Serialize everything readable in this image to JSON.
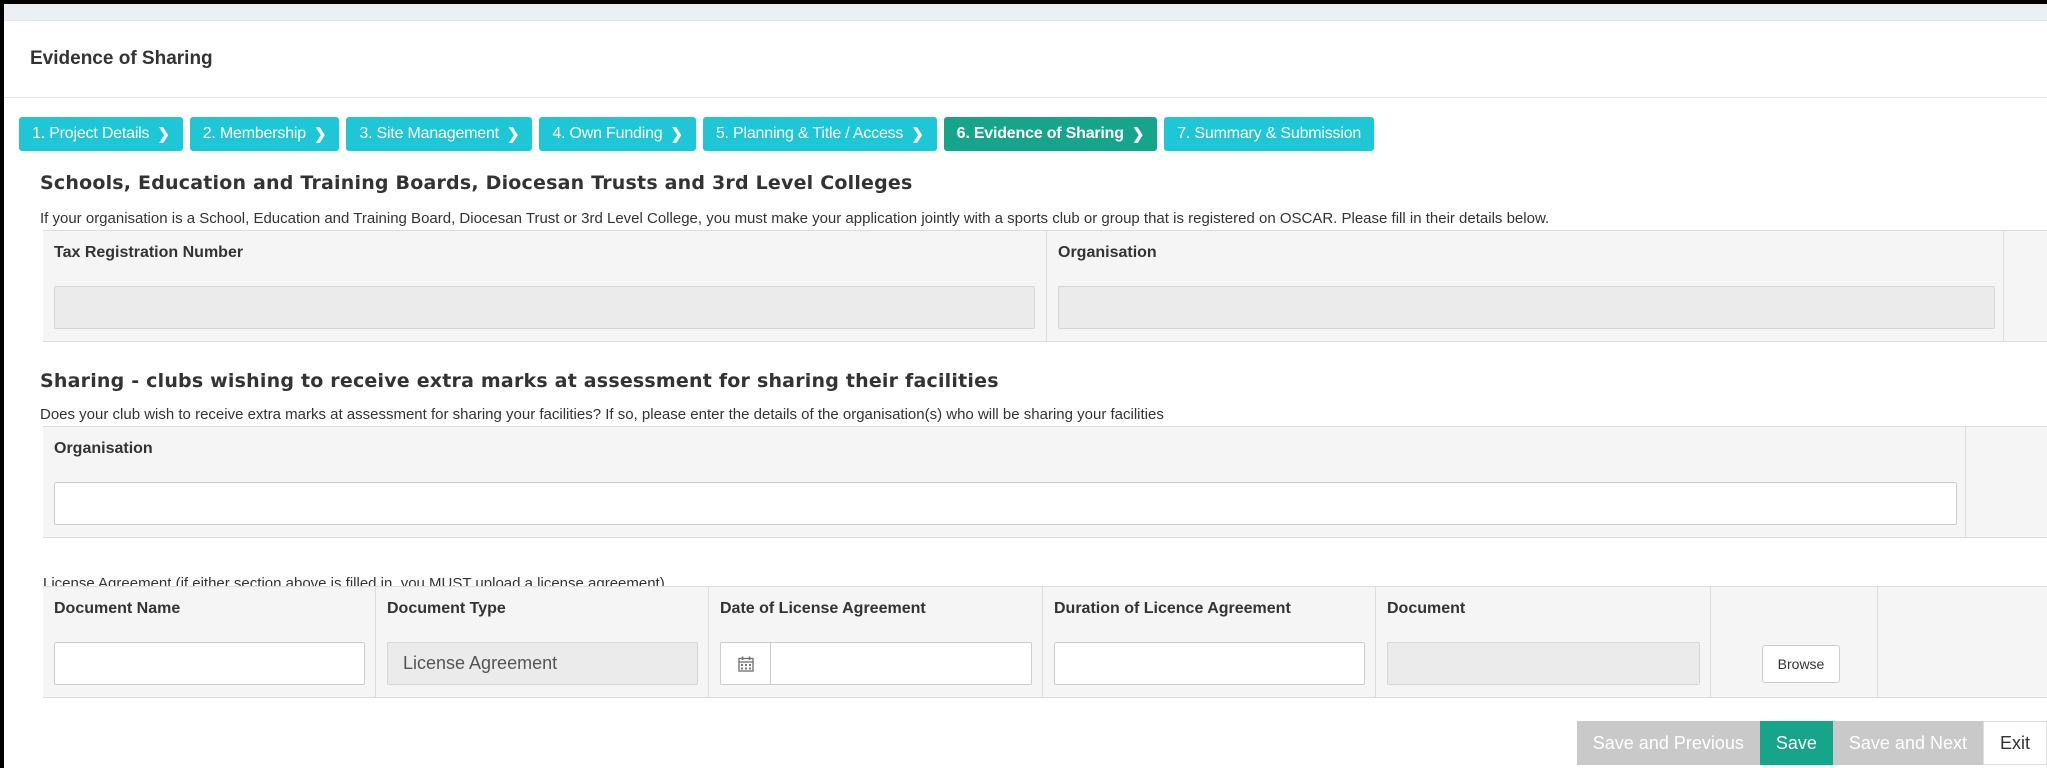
{
  "page": {
    "title": "Evidence of Sharing"
  },
  "tabs": [
    {
      "label": "1. Project Details",
      "active": false
    },
    {
      "label": "2. Membership",
      "active": false
    },
    {
      "label": "3. Site Management",
      "active": false
    },
    {
      "label": "4. Own Funding",
      "active": false
    },
    {
      "label": "5. Planning & Title / Access",
      "active": false
    },
    {
      "label": "6. Evidence of Sharing",
      "active": true
    },
    {
      "label": "7. Summary & Submission",
      "active": false
    }
  ],
  "schools_section": {
    "title": "Schools, Education and Training Boards, Diocesan Trusts and 3rd Level Colleges",
    "description": "If your organisation is a School, Education and Training Board, Diocesan Trust or 3rd Level College, you must make your application jointly with a sports club or group that is registered on OSCAR. Please fill in their details below.",
    "columns": [
      "Tax Registration Number",
      "Organisation"
    ],
    "row": {
      "tax_registration_number": "",
      "organisation": ""
    }
  },
  "sharing_section": {
    "title": "Sharing - clubs wishing to receive extra marks at assessment for sharing their facilities",
    "description": "Does your club wish to receive extra marks at assessment for sharing your facilities? If so, please enter the details of the organisation(s) who will be sharing your facilities",
    "columns": [
      "Organisation"
    ],
    "row": {
      "organisation": ""
    }
  },
  "license_section": {
    "label": "License Agreement (if either section above is filled in, you MUST upload a license agreement)",
    "columns": [
      "Document Name",
      "Document Type",
      "Date of License Agreement",
      "Duration of Licence Agreement",
      "Document",
      ""
    ],
    "row": {
      "document_name": "",
      "document_type": "License Agreement",
      "date": "",
      "duration": "",
      "document": "",
      "browse_label": "Browse"
    }
  },
  "footer_buttons": {
    "save_previous": "Save and Previous",
    "save": "Save",
    "save_next": "Save and Next",
    "exit": "Exit"
  },
  "colors": {
    "tab": "#1ec6d6",
    "tab_active": "#16a58b",
    "save_button": "#16a58b",
    "disabled_button": "#c9c9c9"
  },
  "icons": {
    "tab_chevron": "chevron-right-icon",
    "calendar": "calendar-icon"
  }
}
